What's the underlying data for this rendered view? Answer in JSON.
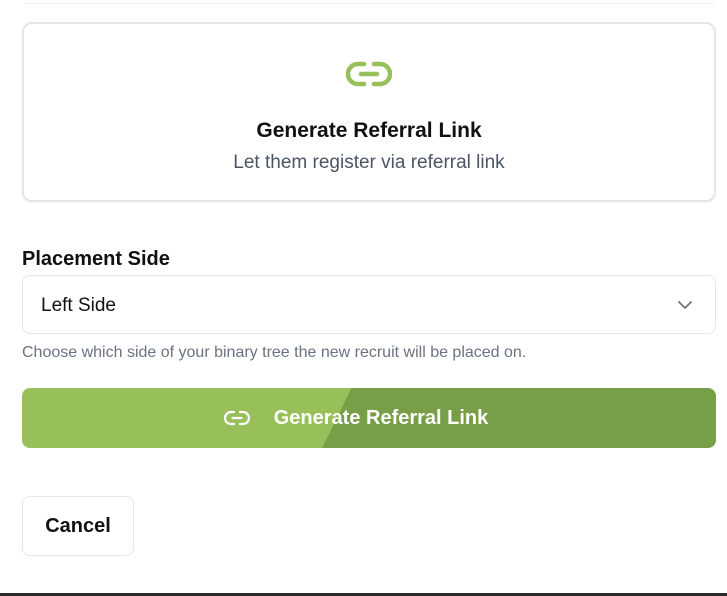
{
  "option_card": {
    "icon": "link-icon",
    "title": "Generate Referral Link",
    "subtitle": "Let them register via referral link"
  },
  "placement": {
    "label": "Placement Side",
    "selected": "Left Side",
    "helper": "Choose which side of your binary tree the new recruit will be placed on."
  },
  "actions": {
    "generate_label": "Generate Referral Link",
    "generate_icon": "link-icon",
    "cancel_label": "Cancel"
  },
  "colors": {
    "accent_light": "#98c05a",
    "accent_dark": "#779f47"
  }
}
